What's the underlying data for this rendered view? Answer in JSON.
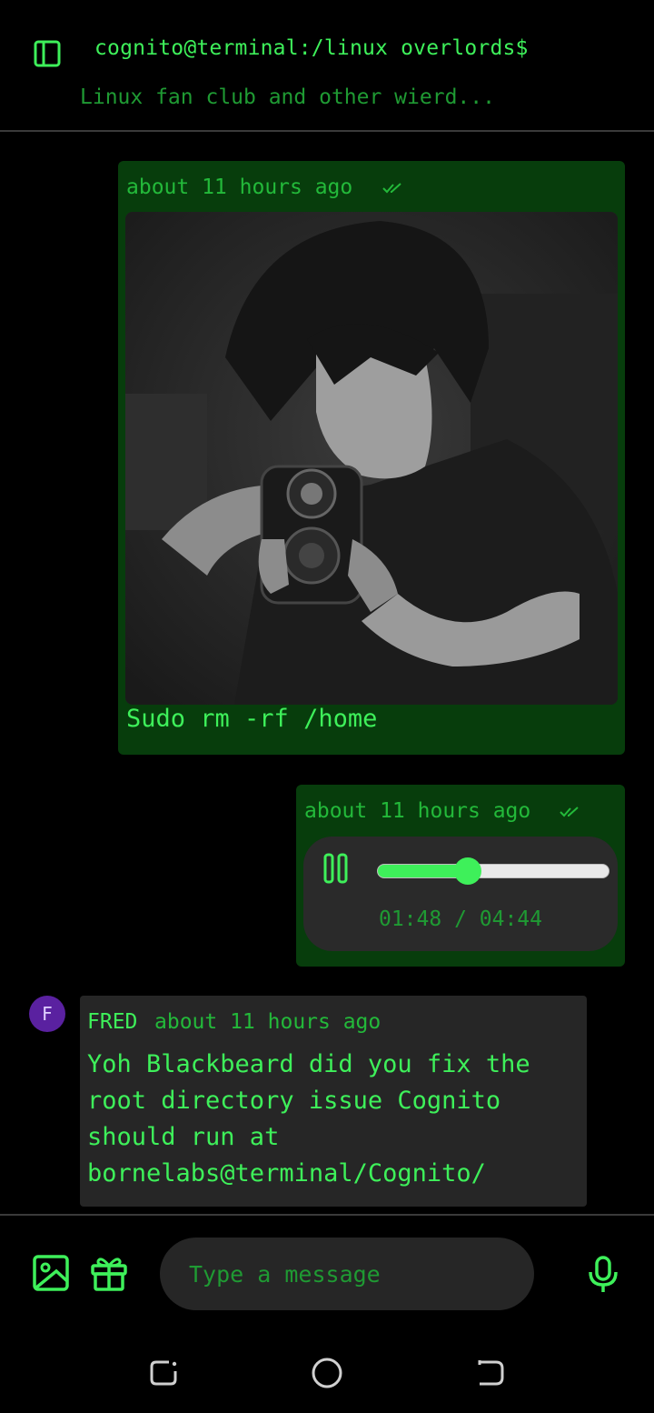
{
  "header": {
    "title": "cognito@terminal:/linux overlords$",
    "subtitle": "Linux fan club and other wierd...",
    "sidebar_icon": "sidebar-panel-icon"
  },
  "messages": [
    {
      "type": "image",
      "direction": "outgoing",
      "time": "about 11 hours ago",
      "status_icon": "double-check-icon",
      "image_alt": "Anime character pointing a gun",
      "caption": "Sudo rm -rf /home"
    },
    {
      "type": "audio",
      "direction": "outgoing",
      "time": "about 11 hours ago",
      "status_icon": "double-check-icon",
      "player": {
        "state": "playing",
        "control_icon": "pause-icon",
        "progress": 0.39,
        "time_text": "01:48 / 04:44"
      }
    },
    {
      "type": "text",
      "direction": "incoming",
      "avatar_letter": "F",
      "sender": "FRED",
      "time": "about 11 hours ago",
      "text": "Yoh Blackbeard did you fix the\nroot directory issue Cognito\nshould run at\nbornelabs@terminal/Cognito/"
    }
  ],
  "composer": {
    "placeholder": "Type a message",
    "value": "",
    "icons": [
      "image-icon",
      "gift-icon",
      "microphone-icon"
    ]
  },
  "nav": {
    "icons": [
      "recent-apps-icon",
      "home-icon",
      "back-icon"
    ]
  },
  "colors": {
    "accent": "#3ef05a",
    "accent_dim": "#1f9a33",
    "bubble_outgoing": "#073d0c",
    "bubble_incoming": "#262626",
    "avatar": "#5a21a0",
    "background": "#000000"
  }
}
